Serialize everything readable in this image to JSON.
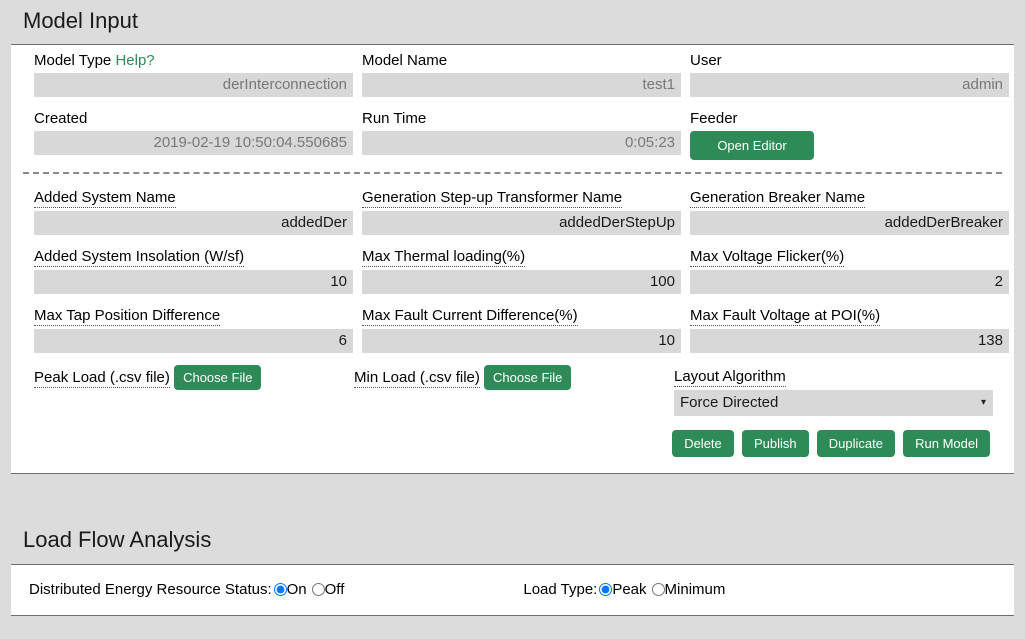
{
  "model_input": {
    "title": "Model Input",
    "basic_fields": [
      {
        "label": "Model Type",
        "help_label": "Help?",
        "value": "derInterconnection",
        "name": "model-type"
      },
      {
        "label": "Model Name",
        "value": "test1",
        "name": "model-name"
      },
      {
        "label": "User",
        "value": "admin",
        "name": "user"
      },
      {
        "label": "Created",
        "value": "2019-02-19 10:50:04.550685",
        "name": "created"
      },
      {
        "label": "Run Time",
        "value": "0:05:23",
        "name": "run-time"
      }
    ],
    "feeder": {
      "label": "Feeder",
      "button_label": "Open Editor"
    },
    "parameter_fields": [
      {
        "label": "Added System Name",
        "value": "addedDer",
        "name": "added-system-name"
      },
      {
        "label": "Generation Step-up Transformer Name",
        "value": "addedDerStepUp",
        "name": "generation-step-up-transformer-name"
      },
      {
        "label": "Generation Breaker Name",
        "value": "addedDerBreaker",
        "name": "generation-breaker-name"
      },
      {
        "label": "Added System Insolation (W/sf)",
        "value": "10",
        "name": "added-system-insolation"
      },
      {
        "label": "Max Thermal loading(%)",
        "value": "100",
        "name": "max-thermal-loading"
      },
      {
        "label": "Max Voltage Flicker(%)",
        "value": "2",
        "name": "max-voltage-flicker"
      },
      {
        "label": "Max Tap Position Difference",
        "value": "6",
        "name": "max-tap-position-difference"
      },
      {
        "label": "Max Fault Current Difference(%)",
        "value": "10",
        "name": "max-fault-current-difference"
      },
      {
        "label": "Max Fault Voltage at POI(%)",
        "value": "138",
        "name": "max-fault-voltage-at-poi"
      }
    ],
    "peak_load": {
      "label": "Peak Load (.csv file)",
      "button_label": "Choose File"
    },
    "min_load": {
      "label": "Min Load (.csv file)",
      "button_label": "Choose File"
    },
    "layout_algorithm": {
      "label": "Layout Algorithm",
      "value": "Force Directed",
      "caret": "▾"
    },
    "actions": {
      "delete": "Delete",
      "publish": "Publish",
      "duplicate": "Duplicate",
      "run_model": "Run Model"
    }
  },
  "load_flow_analysis": {
    "title": "Load Flow Analysis",
    "der_status": {
      "label": "Distributed Energy Resource Status:",
      "options": [
        "On",
        "Off"
      ],
      "selected": "On"
    },
    "load_type": {
      "label": "Load Type:",
      "options": [
        "Peak",
        "Minimum"
      ],
      "selected": "Peak"
    }
  },
  "colors": {
    "accent_green": "#2e8b57",
    "page_background": "#dcdcdc",
    "panel_background": "#ffffff",
    "input_background": "#d8d8d8"
  }
}
